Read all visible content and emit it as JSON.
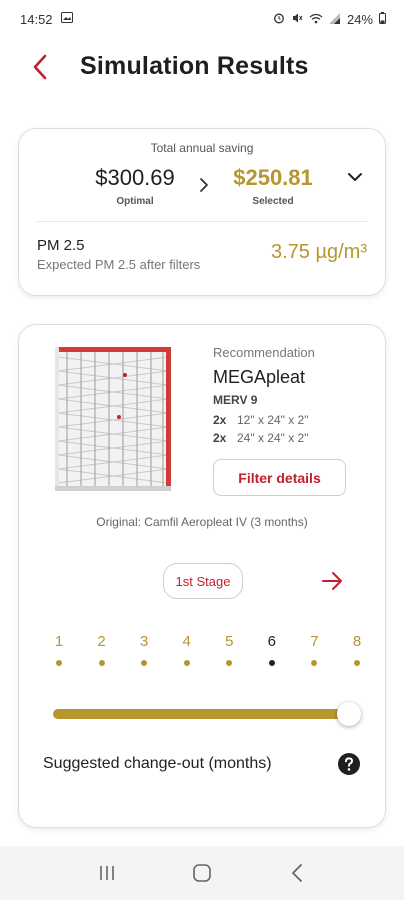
{
  "status_bar": {
    "time": "14:52",
    "battery": "24%"
  },
  "header": {
    "title": "Simulation Results"
  },
  "saving": {
    "label": "Total annual saving",
    "optimal_value": "$300.69",
    "optimal_label": "Optimal",
    "selected_value": "$250.81",
    "selected_label": "Selected"
  },
  "pm": {
    "title": "PM 2.5",
    "subtitle": "Expected PM 2.5 after filters",
    "value": "3.75 µg/m³"
  },
  "recommendation": {
    "label": "Recommendation",
    "product": "MEGApleat",
    "merv": "MERV 9",
    "sizes": [
      {
        "qty": "2x",
        "size": "12\" x 24\" x 2\""
      },
      {
        "qty": "2x",
        "size": "24\" x 24\" x 2\""
      }
    ],
    "details_button": "Filter details",
    "original": "Original: Camfil Aeropleat IV (3 months)",
    "stage_button": "1st Stage"
  },
  "changeout": {
    "months": [
      "1",
      "2",
      "3",
      "4",
      "5",
      "6",
      "7",
      "8"
    ],
    "selected_index": 5,
    "slider_fraction": 1.0,
    "label": "Suggested change-out (months)"
  },
  "colors": {
    "accent_red": "#c2202e",
    "gold": "#b8962e"
  }
}
